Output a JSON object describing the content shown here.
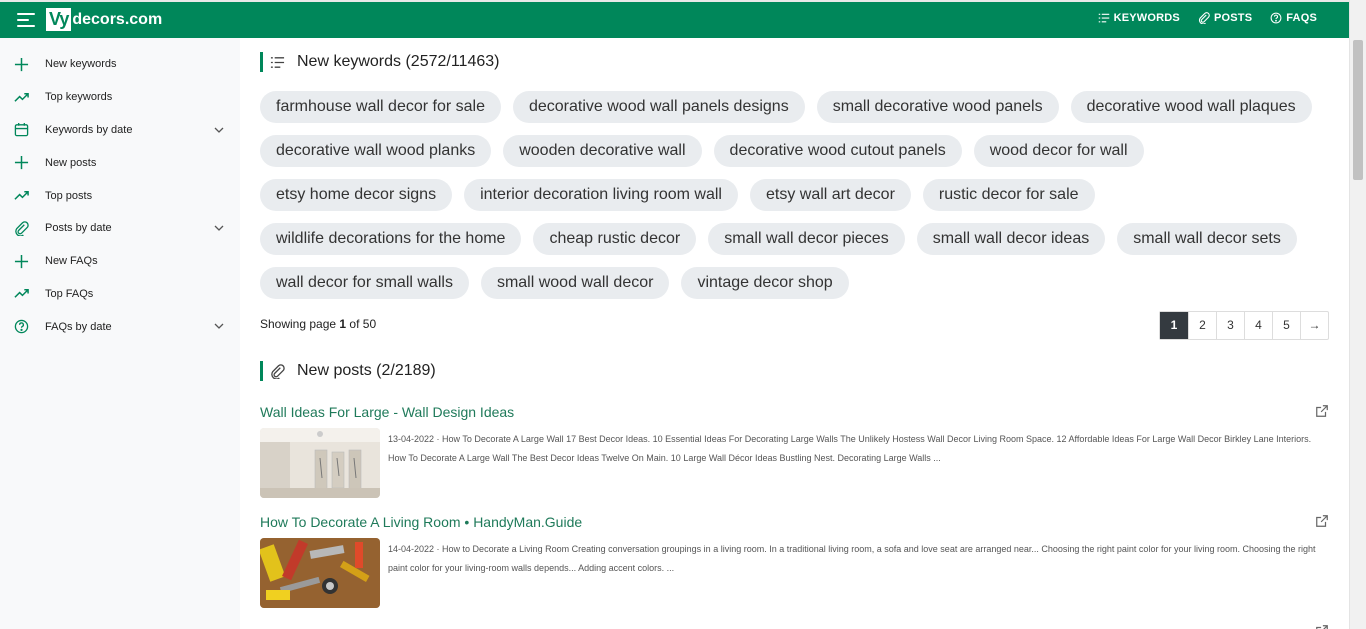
{
  "header": {
    "logo_mark": "Vy",
    "logo_rest": "decors.com",
    "nav": [
      {
        "label": "KEYWORDS",
        "icon": "list-icon"
      },
      {
        "label": "POSTS",
        "icon": "paperclip-icon"
      },
      {
        "label": "FAQS",
        "icon": "question-circle-icon"
      }
    ]
  },
  "sidebar": {
    "items": [
      {
        "label": "New keywords",
        "icon": "plus-icon"
      },
      {
        "label": "Top keywords",
        "icon": "trending-up-icon"
      },
      {
        "label": "Keywords by date",
        "icon": "calendar-icon",
        "expandable": true
      },
      {
        "label": "New posts",
        "icon": "plus-icon"
      },
      {
        "label": "Top posts",
        "icon": "trending-up-icon"
      },
      {
        "label": "Posts by date",
        "icon": "paperclip-icon",
        "expandable": true
      },
      {
        "label": "New FAQs",
        "icon": "plus-icon"
      },
      {
        "label": "Top FAQs",
        "icon": "trending-up-icon"
      },
      {
        "label": "FAQs by date",
        "icon": "question-circle-icon",
        "expandable": true
      }
    ]
  },
  "keywords_section": {
    "title": "New keywords (2572/11463)",
    "chips": [
      "farmhouse wall decor for sale",
      "decorative wood wall panels designs",
      "small decorative wood panels",
      "decorative wood wall plaques",
      "decorative wall wood planks",
      "wooden decorative wall",
      "decorative wood cutout panels",
      "wood decor for wall",
      "etsy home decor signs",
      "interior decoration living room wall",
      "etsy wall art decor",
      "rustic decor for sale",
      "wildlife decorations for the home",
      "cheap rustic decor",
      "small wall decor pieces",
      "small wall decor ideas",
      "small wall decor sets",
      "wall decor for small walls",
      "small wood wall decor",
      "vintage decor shop"
    ],
    "showing_prefix": "Showing page ",
    "showing_page": "1",
    "showing_suffix": " of 50",
    "pages": [
      "1",
      "2",
      "3",
      "4",
      "5",
      "→"
    ],
    "active_page": "1"
  },
  "posts_section": {
    "title": "New posts (2/2189)",
    "posts": [
      {
        "title": "Wall Ideas For Large - Wall Design Ideas",
        "date": "13-04-2022",
        "excerpt": "How To Decorate A Large Wall 17 Best Decor Ideas. 10 Essential Ideas For Decorating Large Walls The Unlikely Hostess Wall Decor Living Room Space. 12 Affordable Ideas For Large Wall Decor Birkley Lane Interiors. How To Decorate A Large Wall The Best Decor Ideas Twelve On Main. 10 Large Wall Décor Ideas Bustling Nest. Decorating Large Walls ..."
      },
      {
        "title": "How To Decorate A Living Room • HandyMan.Guide",
        "date": "14-04-2022",
        "excerpt": "How to Decorate a Living Room Creating conversation groupings in a living room. In a traditional living room, a sofa and love seat are arranged near... Choosing the right paint color for your living room. Choosing the right paint color for your living-room walls depends... Adding accent colors. ..."
      }
    ]
  }
}
